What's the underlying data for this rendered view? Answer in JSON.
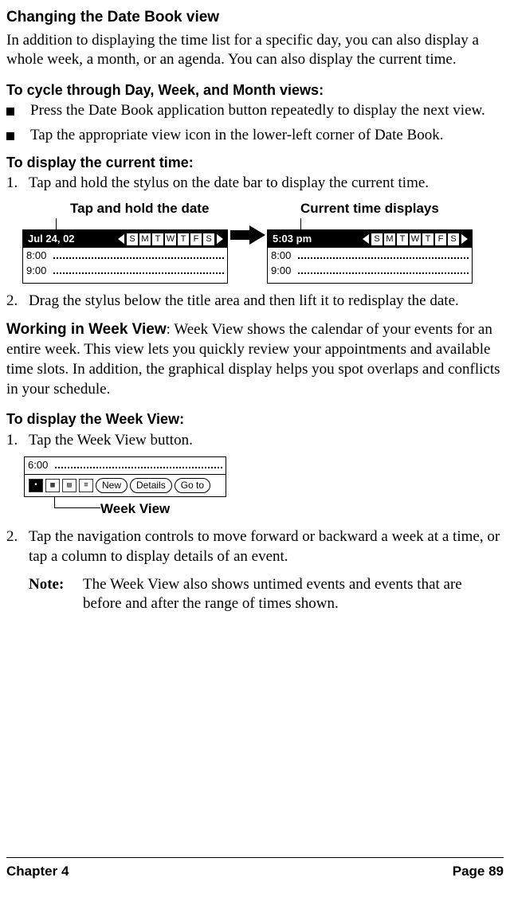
{
  "h3": "Changing the Date Book view",
  "intro": "In addition to displaying the time list for a specific day, you can also display a whole week, a month, or an agenda. You can also display the current time.",
  "h4a": "To cycle through Day, Week, and Month views:",
  "bullets": [
    " Press the Date Book application button repeatedly to display the next view.",
    "Tap the appropriate view icon in the lower-left corner of Date Book."
  ],
  "h4b": "To display the current time:",
  "step1": "Tap and hold the stylus on the date bar to display the current time.",
  "callout_left": "Tap and hold the date",
  "callout_right": "Current time displays",
  "pda_left_title": "Jul 24, 02",
  "pda_right_title": "5:03 pm",
  "days": [
    "S",
    "M",
    "T",
    "W",
    "T",
    "F",
    "S"
  ],
  "times": [
    "8:00",
    "9:00"
  ],
  "step2": " Drag the stylus below the title area and then lift it to redisplay the date.",
  "runin": "Working in Week View",
  "week_para": ": Week View shows the calendar of your events for an entire week. This view lets you quickly review your appointments and available time slots. In addition, the graphical display helps you spot overlaps and conflicts in your schedule.",
  "h4c": "To display the Week View:",
  "week_step1": "Tap the Week View button.",
  "toolbar_time": "6:00",
  "btn_new": "New",
  "btn_details": "Details",
  "btn_goto": "Go to",
  "toolbar_callout": "Week View",
  "week_step2": "Tap the navigation controls to move forward or backward a week at a time, or tap a column to display details of an event.",
  "note_label": "Note:",
  "note_text": "The Week View also shows untimed events and events that are before and after the range of times shown.",
  "footer_left": "Chapter 4",
  "footer_right": "Page 89"
}
